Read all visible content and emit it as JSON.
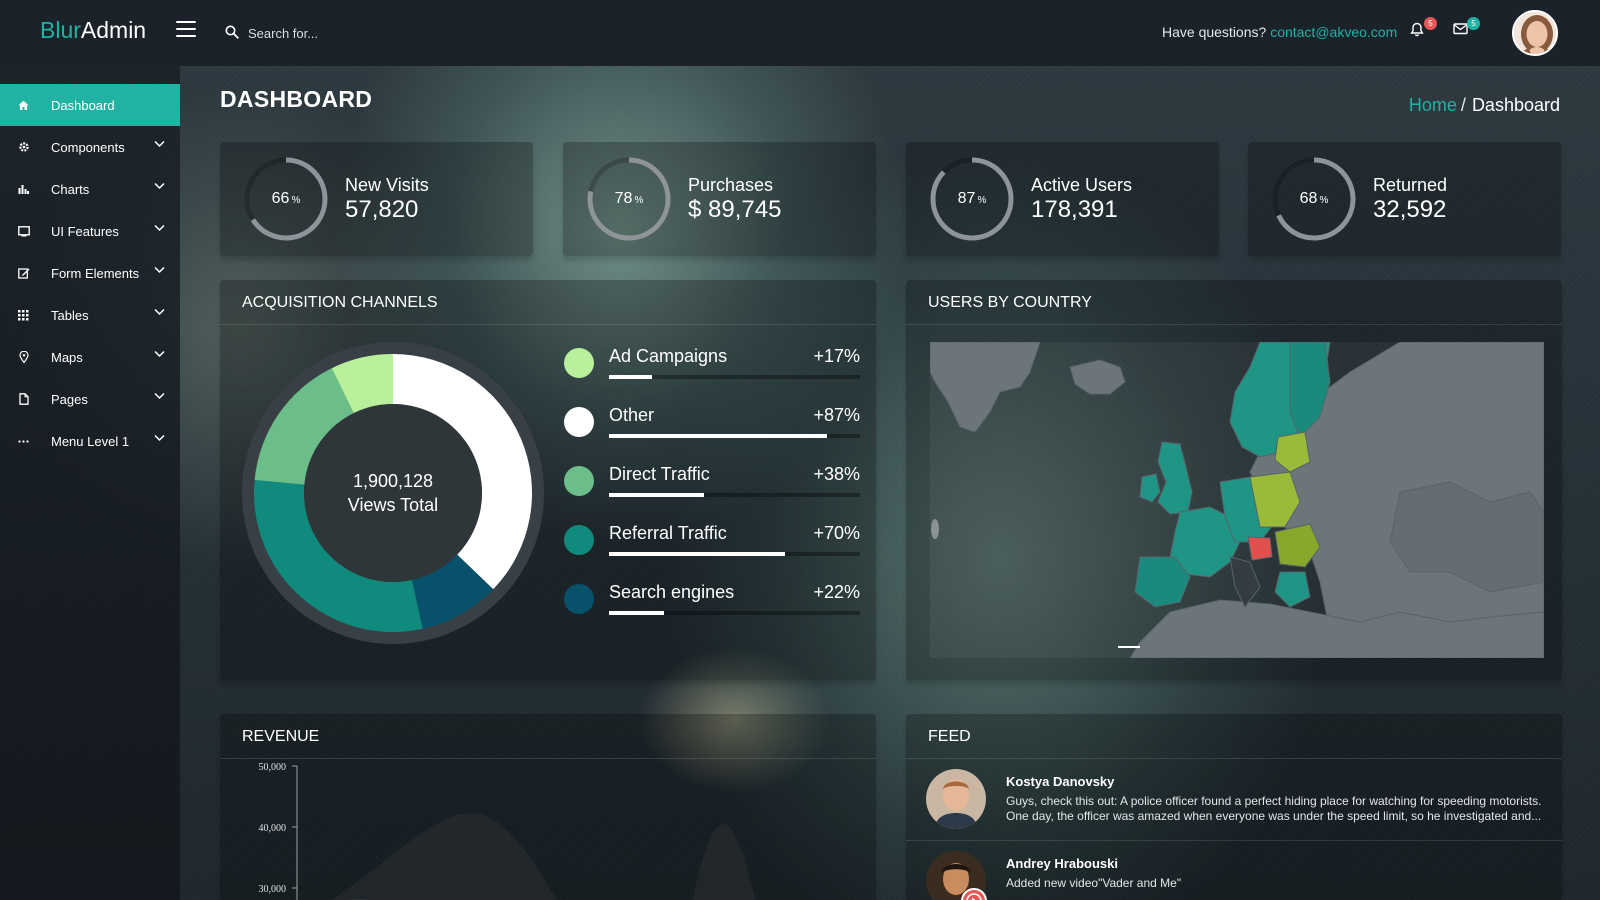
{
  "app": {
    "logo_part1": "Blur",
    "logo_part2": "Admin"
  },
  "header": {
    "search_placeholder": "Search for...",
    "help_text": "Have questions?",
    "help_email": "contact@akveo.com",
    "notifications_count": "5",
    "messages_count": "5"
  },
  "sidebar": {
    "items": [
      {
        "label": "Dashboard",
        "icon": "home-icon"
      },
      {
        "label": "Components",
        "icon": "gear-icon"
      },
      {
        "label": "Charts",
        "icon": "bar-chart-icon"
      },
      {
        "label": "UI Features",
        "icon": "monitor-icon"
      },
      {
        "label": "Form Elements",
        "icon": "edit-icon"
      },
      {
        "label": "Tables",
        "icon": "grid-icon"
      },
      {
        "label": "Maps",
        "icon": "map-pin-icon"
      },
      {
        "label": "Pages",
        "icon": "file-icon"
      },
      {
        "label": "Menu Level 1",
        "icon": "ellipsis-icon"
      }
    ]
  },
  "page": {
    "title": "DASHBOARD",
    "breadcrumb_home": "Home",
    "breadcrumb_separator": "/",
    "breadcrumb_current": "Dashboard"
  },
  "stats": [
    {
      "label": "New Visits",
      "value": "57,820",
      "percent": "66",
      "fraction": 0.66
    },
    {
      "label": "Purchases",
      "value": "$ 89,745",
      "percent": "78",
      "fraction": 0.78
    },
    {
      "label": "Active Users",
      "value": "178,391",
      "percent": "87",
      "fraction": 0.87
    },
    {
      "label": "Returned",
      "value": "32,592",
      "percent": "68",
      "fraction": 0.68
    }
  ],
  "acquisition": {
    "title": "ACQUISITION CHANNELS",
    "center_value": "1,900,128",
    "center_label": "Views Total",
    "channels": [
      {
        "name": "Ad Campaigns",
        "percent": "+17%",
        "fraction": 0.17,
        "color": "#b8f09c"
      },
      {
        "name": "Other",
        "percent": "+87%",
        "fraction": 0.87,
        "color": "#ffffff"
      },
      {
        "name": "Direct Traffic",
        "percent": "+38%",
        "fraction": 0.38,
        "color": "#6bbd8a"
      },
      {
        "name": "Referral Traffic",
        "percent": "+70%",
        "fraction": 0.7,
        "color": "#0f8a7c"
      },
      {
        "name": "Search engines",
        "percent": "+22%",
        "fraction": 0.22,
        "color": "#07526a"
      }
    ],
    "donut_order": [
      "Other",
      "Search engines",
      "Referral Traffic",
      "Direct Traffic",
      "Ad Campaigns"
    ]
  },
  "users_by_country": {
    "title": "USERS BY COUNTRY"
  },
  "revenue": {
    "title": "REVENUE",
    "y_ticks": [
      "50,000",
      "40,000",
      "30,000"
    ]
  },
  "feed": {
    "title": "FEED",
    "items": [
      {
        "author": "Kostya Danovsky",
        "text": "Guys, check this out: A police officer found a perfect hiding place for watching for speeding motorists. One day, the officer was amazed when everyone was under the speed limit, so he investigated and..."
      },
      {
        "author": "Andrey Hrabouski",
        "text": "Added new video\"Vader and Me\""
      }
    ]
  },
  "colors": {
    "accent": "#20b2a3",
    "alert": "#e85656",
    "topbar": "#1b222a"
  }
}
